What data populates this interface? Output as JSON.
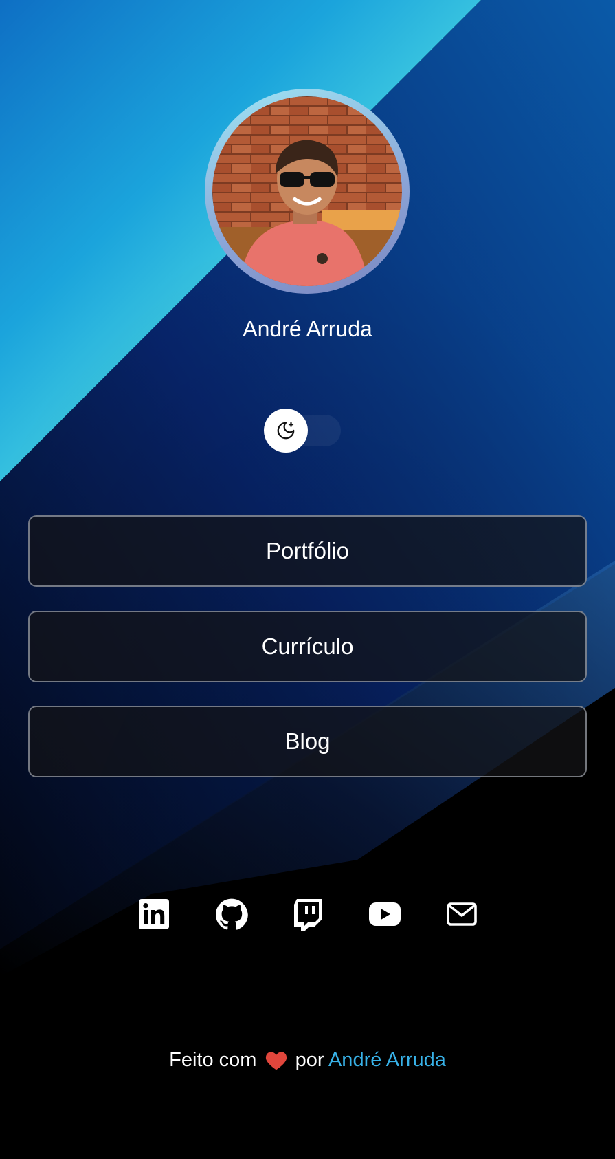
{
  "profile": {
    "name": "André Arruda",
    "avatar_alt": "André Arruda"
  },
  "theme_toggle": {
    "icon": "moon-stars-icon",
    "state": "dark"
  },
  "links": [
    {
      "label": "Portfólio"
    },
    {
      "label": "Currículo"
    },
    {
      "label": "Blog"
    }
  ],
  "social": [
    {
      "icon": "linkedin-icon"
    },
    {
      "icon": "github-icon"
    },
    {
      "icon": "twitch-icon"
    },
    {
      "icon": "youtube-icon"
    },
    {
      "icon": "mail-icon"
    }
  ],
  "footer": {
    "prefix": "Feito com",
    "middle": "por",
    "author": "André Arruda"
  },
  "colors": {
    "accent": "#38b2e8",
    "background": "#000000",
    "gradient_cyan": "#6ff2e2",
    "gradient_blue": "#0b57a8",
    "gradient_navy": "#0a1f5c"
  }
}
